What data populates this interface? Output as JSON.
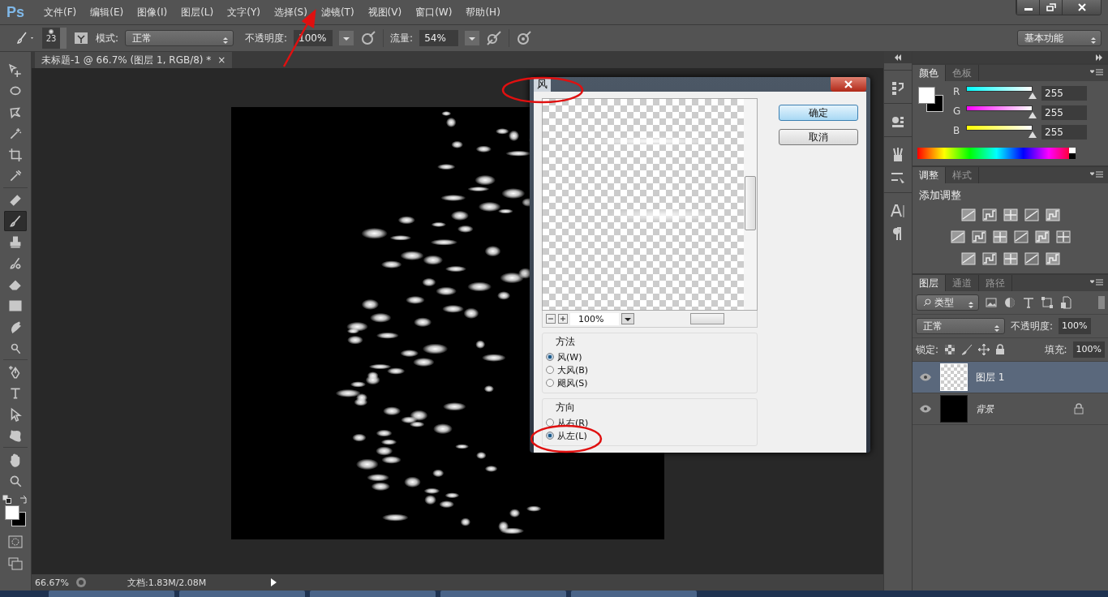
{
  "app": {
    "logo": "Ps"
  },
  "menu": [
    "文件(F)",
    "编辑(E)",
    "图像(I)",
    "图层(L)",
    "文字(Y)",
    "选择(S)",
    "滤镜(T)",
    "视图(V)",
    "窗口(W)",
    "帮助(H)"
  ],
  "options_bar": {
    "brush_size": "23",
    "mode_label": "模式:",
    "mode": "正常",
    "opacity_label": "不透明度:",
    "opacity": "100%",
    "flow_label": "流量:",
    "flow": "54%",
    "workspace": "基本功能"
  },
  "document_tab": {
    "title": "未标题-1 @ 66.7% (图层 1, RGB/8) *",
    "close": "×"
  },
  "tools": [
    {
      "kind": "move",
      "selected": false
    },
    {
      "kind": "marquee",
      "selected": false
    },
    {
      "kind": "lasso",
      "selected": false
    },
    {
      "kind": "wand",
      "selected": false
    },
    {
      "kind": "crop",
      "selected": false
    },
    {
      "kind": "eyedropper",
      "selected": false
    },
    {
      "kind": "heal",
      "selected": false
    },
    {
      "kind": "brush",
      "selected": true
    },
    {
      "kind": "stamp",
      "selected": false
    },
    {
      "kind": "history",
      "selected": false
    },
    {
      "kind": "eraser",
      "selected": false
    },
    {
      "kind": "gradient",
      "selected": false
    },
    {
      "kind": "smudge",
      "selected": false
    },
    {
      "kind": "dodge",
      "selected": false
    },
    {
      "kind": "pen",
      "selected": false
    },
    {
      "kind": "type",
      "selected": false
    },
    {
      "kind": "select",
      "selected": false
    },
    {
      "kind": "shape",
      "selected": false
    },
    {
      "kind": "hand",
      "selected": false
    },
    {
      "kind": "zoom",
      "selected": false
    }
  ],
  "dialog": {
    "title": "风",
    "ok": "确定",
    "cancel": "取消",
    "zoom": "100%",
    "method": {
      "legend": "方法",
      "options": [
        {
          "label": "风(W)",
          "selected": true
        },
        {
          "label": "大风(B)",
          "selected": false
        },
        {
          "label": "飓风(S)",
          "selected": false
        }
      ]
    },
    "direction": {
      "legend": "方向",
      "options": [
        {
          "label": "从右(R)",
          "selected": false
        },
        {
          "label": "从左(L)",
          "selected": true
        }
      ]
    }
  },
  "color_panel": {
    "tabs": [
      {
        "label": "颜色",
        "selected": true
      },
      {
        "label": "色板",
        "selected": false
      }
    ],
    "channels": [
      {
        "name": "R",
        "level": 1,
        "value": "255"
      },
      {
        "name": "G",
        "level": 1,
        "value": "255"
      },
      {
        "name": "B",
        "level": 1,
        "value": "255"
      }
    ]
  },
  "adjustments_panel": {
    "tabs": [
      {
        "label": "调整",
        "selected": true
      },
      {
        "label": "样式",
        "selected": false
      }
    ],
    "heading": "添加调整"
  },
  "layers_panel": {
    "tabs": [
      {
        "label": "图层",
        "selected": true
      },
      {
        "label": "通道",
        "selected": false
      },
      {
        "label": "路径",
        "selected": false
      }
    ],
    "filter": "类型",
    "blend_mode": "正常",
    "opacity_label": "不透明度:",
    "opacity": "100%",
    "lock_label": "锁定:",
    "fill_label": "填充:",
    "fill": "100%",
    "layers": [
      {
        "name": "图层 1",
        "selected": true,
        "kind": "transparent",
        "locked": false
      },
      {
        "name": "背景",
        "selected": false,
        "kind": "black",
        "locked": true
      }
    ]
  },
  "status_bar": {
    "zoom": "66.67%",
    "document_info": "文档:1.83M/2.08M"
  }
}
